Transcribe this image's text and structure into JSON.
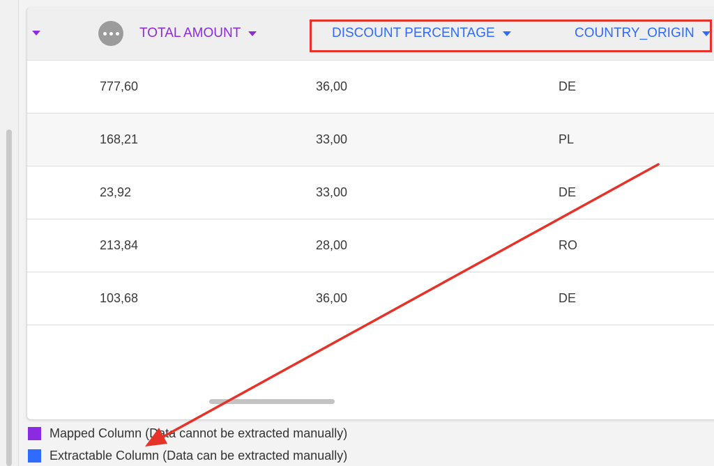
{
  "colors": {
    "mapped": "#8a2be2",
    "extractable": "#2f6bff",
    "annotation_red": "#e53329"
  },
  "header": {
    "more_icon": "more-horizontal-icon",
    "columns": [
      {
        "label": "TOTAL AMOUNT",
        "type": "mapped"
      },
      {
        "label": "DISCOUNT PERCENTAGE",
        "type": "extractable"
      },
      {
        "label": "COUNTRY_ORIGIN",
        "type": "extractable"
      }
    ]
  },
  "rows": [
    {
      "total_amount": "777,60",
      "discount_percentage": "36,00",
      "country_origin": "DE"
    },
    {
      "total_amount": "168,21",
      "discount_percentage": "33,00",
      "country_origin": "PL"
    },
    {
      "total_amount": "23,92",
      "discount_percentage": "33,00",
      "country_origin": "DE"
    },
    {
      "total_amount": "213,84",
      "discount_percentage": "28,00",
      "country_origin": "RO"
    },
    {
      "total_amount": "103,68",
      "discount_percentage": "36,00",
      "country_origin": "DE"
    }
  ],
  "legend": [
    {
      "label": "Mapped Column (Data cannot be extracted manually)",
      "type": "mapped"
    },
    {
      "label": "Extractable Column (Data can be extracted manually)",
      "type": "extractable"
    }
  ]
}
